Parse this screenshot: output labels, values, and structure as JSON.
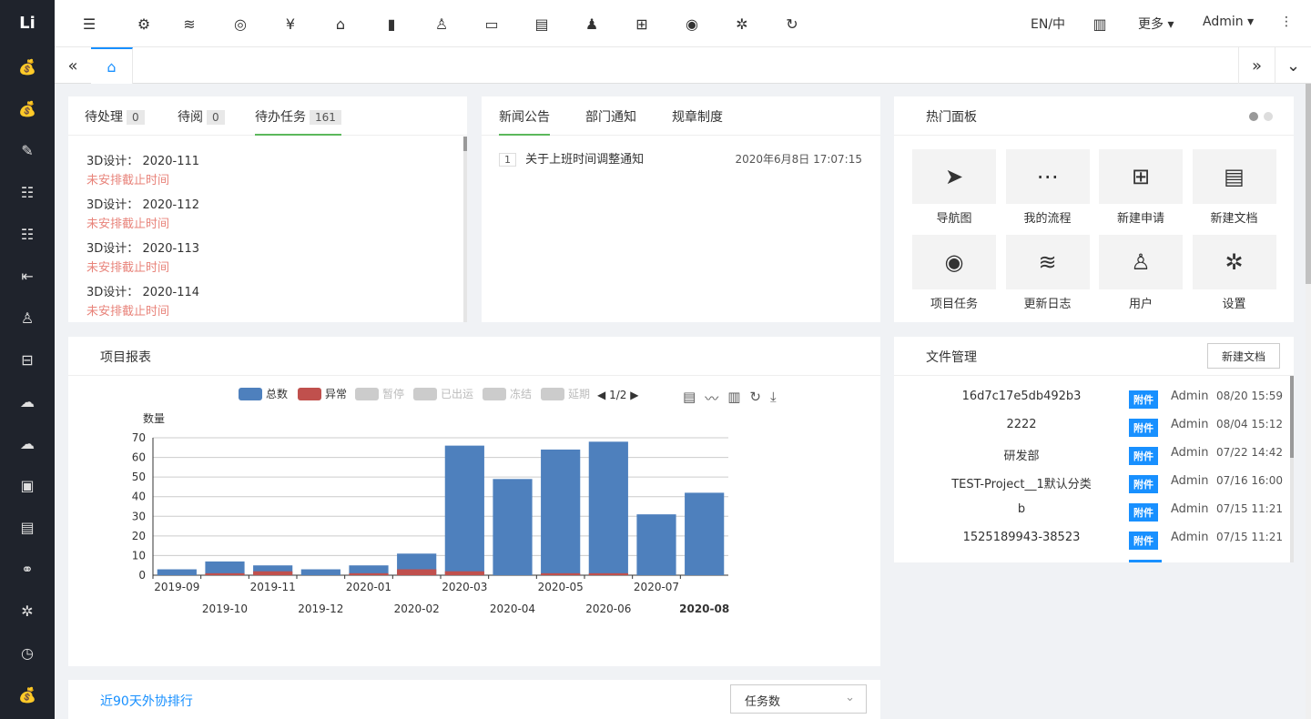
{
  "leftbar": {
    "logo": "Li",
    "icons": [
      "money-bag-icon",
      "money-bag-icon",
      "edit-icon",
      "list-icon",
      "list-icon",
      "outdent-icon",
      "user-icon",
      "bus-icon",
      "cloud-icon",
      "cloud-icon",
      "money-screen-icon",
      "clipboard-icon",
      "handshake-icon",
      "gear-clock-icon",
      "clock-icon",
      "money-bag-icon"
    ]
  },
  "topbar": {
    "lang": "EN/中",
    "more": "更多",
    "user": "Admin"
  },
  "todo": {
    "tabs": [
      {
        "label": "待处理",
        "count": "0"
      },
      {
        "label": "待阅",
        "count": "0"
      },
      {
        "label": "待办任务",
        "count": "161"
      }
    ],
    "tasks": [
      {
        "title": "3D设计：",
        "code": "2020-111",
        "note": "未安排截止时间"
      },
      {
        "title": "3D设计：",
        "code": "2020-112",
        "note": "未安排截止时间"
      },
      {
        "title": "3D设计：",
        "code": "2020-113",
        "note": "未安排截止时间"
      },
      {
        "title": "3D设计：",
        "code": "2020-114",
        "note": "未安排截止时间"
      }
    ]
  },
  "news": {
    "tabs": [
      "新闻公告",
      "部门通知",
      "规章制度"
    ],
    "items": [
      {
        "index": "1",
        "title": "关于上班时间调整通知",
        "date": "2020年6月8日 17:07:15"
      }
    ]
  },
  "hot": {
    "title": "热门面板",
    "items": [
      {
        "label": "导航图",
        "icon": "send-icon"
      },
      {
        "label": "我的流程",
        "icon": "flow-icon"
      },
      {
        "label": "新建申请",
        "icon": "add-square-icon"
      },
      {
        "label": "新建文档",
        "icon": "new-doc-icon"
      },
      {
        "label": "项目任务",
        "icon": "compass-icon"
      },
      {
        "label": "更新日志",
        "icon": "layers-icon"
      },
      {
        "label": "用户",
        "icon": "user-icon"
      },
      {
        "label": "设置",
        "icon": "gear-icon"
      }
    ]
  },
  "report": {
    "title": "项目报表",
    "legend": [
      {
        "name": "总数",
        "color": "#4e80bd",
        "active": true
      },
      {
        "name": "异常",
        "color": "#c0504d",
        "active": true
      },
      {
        "name": "暂停",
        "color": "#cccccc",
        "active": false
      },
      {
        "name": "已出运",
        "color": "#cccccc",
        "active": false
      },
      {
        "name": "冻结",
        "color": "#cccccc",
        "active": false
      },
      {
        "name": "延期",
        "color": "#cccccc",
        "active": false
      }
    ],
    "pager": "1/2"
  },
  "chart_data": {
    "type": "bar",
    "ylabel": "数量",
    "ylim": [
      0,
      70
    ],
    "yticks": [
      "0",
      "10",
      "20",
      "30",
      "40",
      "50",
      "60",
      "70"
    ],
    "categories": [
      "2019-09",
      "2019-10",
      "2019-11",
      "2019-12",
      "2020-01",
      "2020-02",
      "2020-03",
      "2020-04",
      "2020-05",
      "2020-06",
      "2020-07",
      "2020-08"
    ],
    "series": [
      {
        "name": "总数",
        "color": "#4e80bd",
        "values": [
          3,
          7,
          5,
          3,
          5,
          11,
          66,
          49,
          64,
          68,
          31,
          42
        ]
      },
      {
        "name": "异常",
        "color": "#c0504d",
        "values": [
          0,
          1,
          2,
          0,
          1,
          3,
          2,
          0,
          1,
          1,
          0,
          0
        ]
      }
    ],
    "grid": true,
    "legend": "top"
  },
  "files": {
    "title": "文件管理",
    "new_button": "新建文档",
    "rows": [
      {
        "name": "16d7c17e5db492b3",
        "tag": "附件",
        "owner": "Admin",
        "time": "08/20 15:59"
      },
      {
        "name": "2222",
        "tag": "附件",
        "owner": "Admin",
        "time": "08/04 15:12"
      },
      {
        "name": "研发部",
        "tag": "附件",
        "owner": "Admin",
        "time": "07/22 14:42"
      },
      {
        "name": "TEST-Project__1默认分类",
        "tag": "附件",
        "owner": "Admin",
        "time": "07/16 16:00"
      },
      {
        "name": "b",
        "tag": "附件",
        "owner": "Admin",
        "time": "07/15 11:21"
      },
      {
        "name": "1525189943-38523",
        "tag": "附件",
        "owner": "Admin",
        "time": "07/15 11:21"
      }
    ]
  },
  "ranking": {
    "title": "近90天外协排行",
    "select_value": "任务数"
  }
}
